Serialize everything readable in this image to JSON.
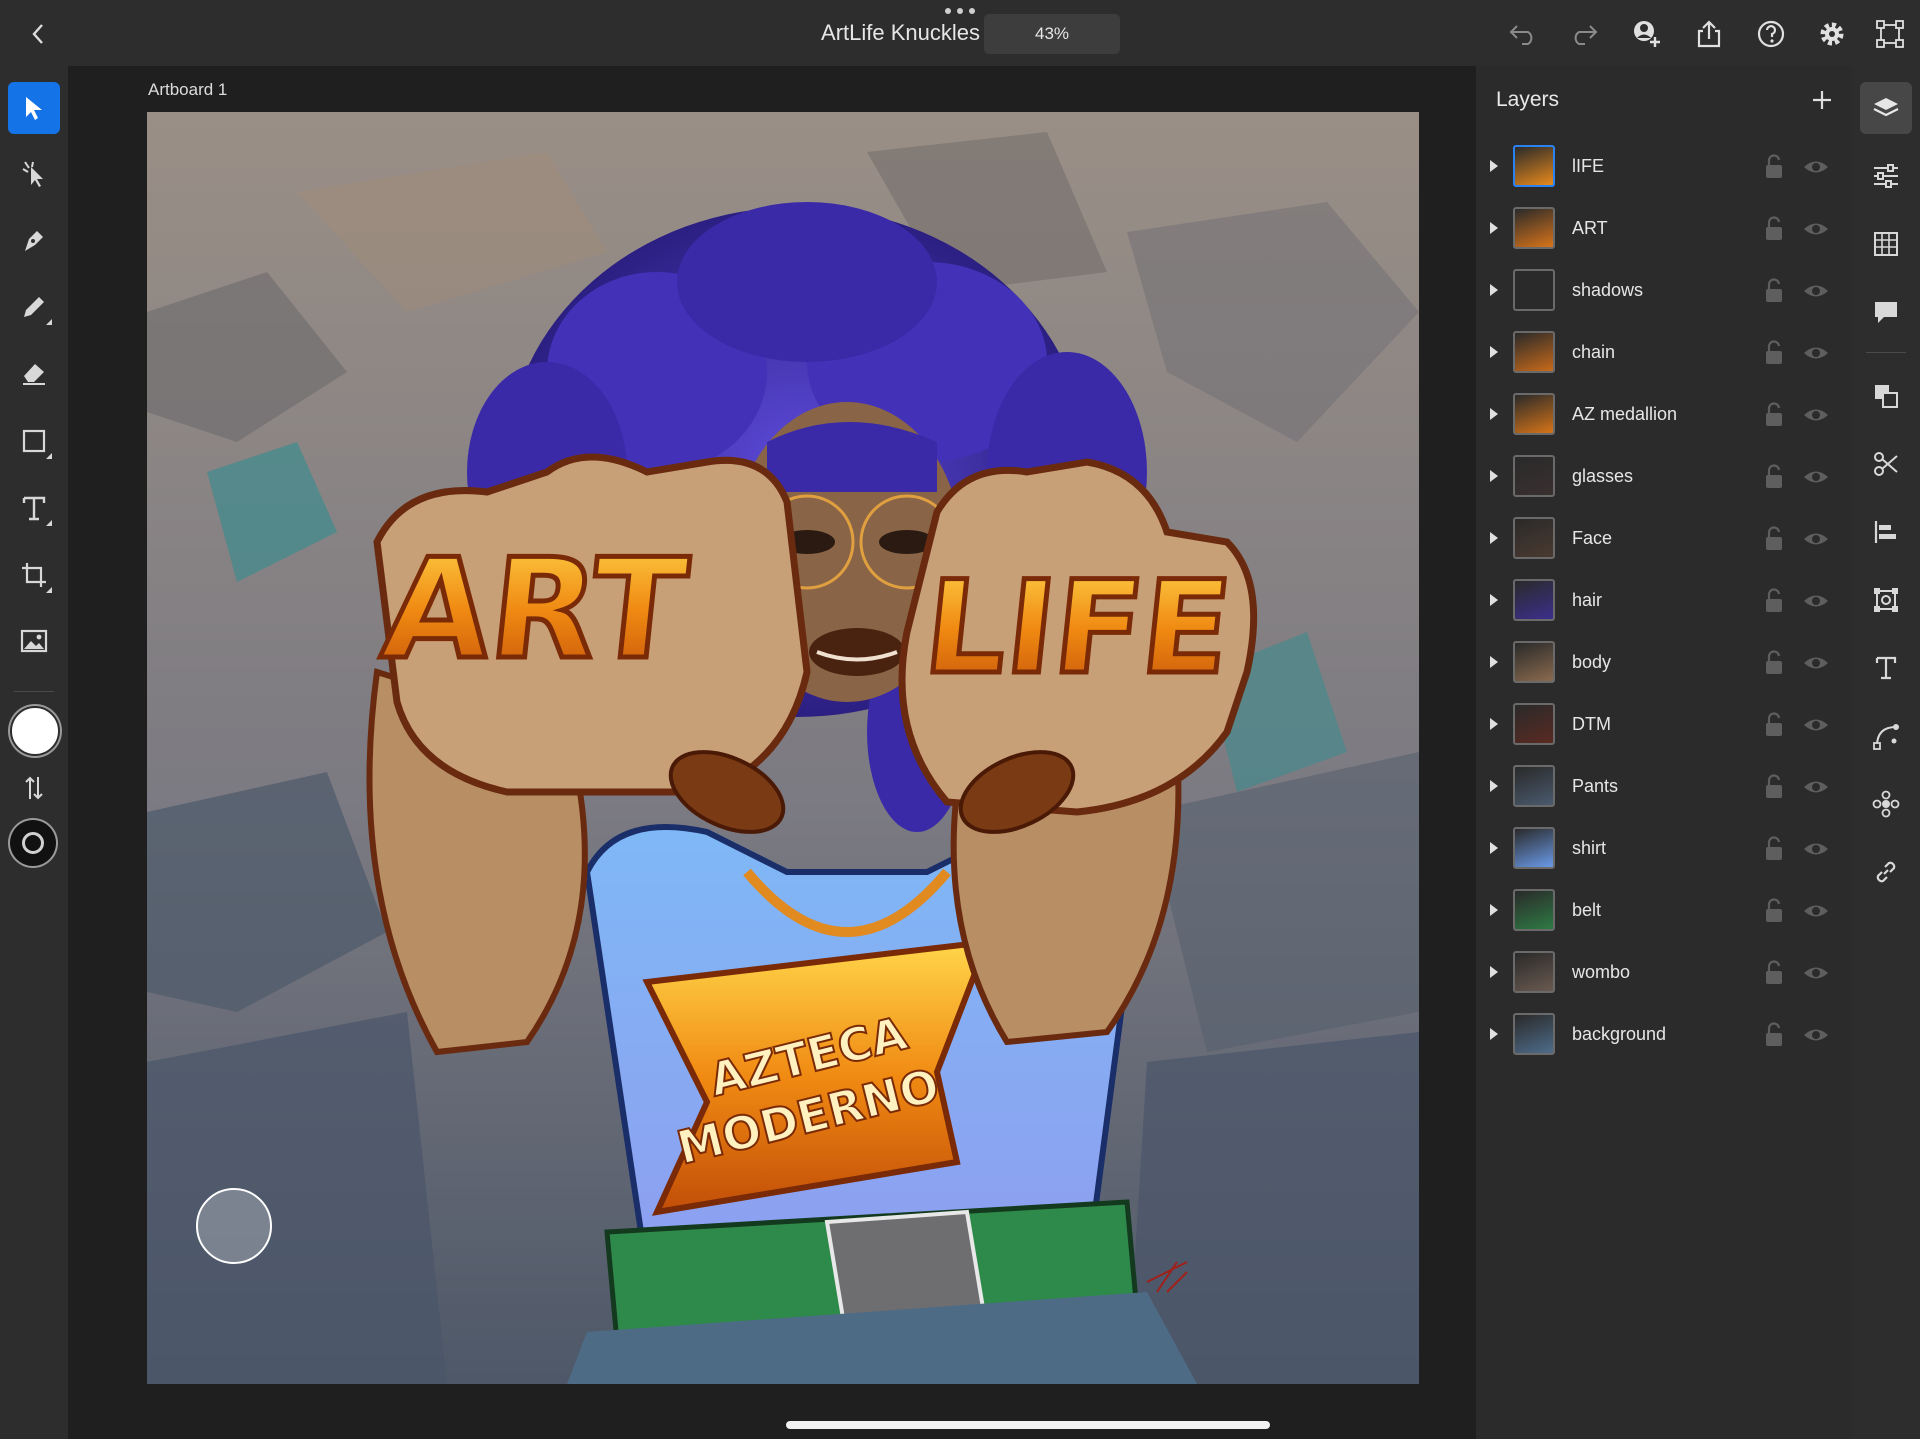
{
  "document": {
    "title": "ArtLife Knuckles",
    "zoom": "43%"
  },
  "canvas": {
    "artboard_label": "Artboard 1"
  },
  "artwork": {
    "headline_left": "ART",
    "headline_right": "LIFE",
    "medallion_line1": "AZTECA",
    "medallion_line2": "MODERNO"
  },
  "layers": {
    "title": "Layers",
    "items": [
      {
        "name": "lIFE",
        "selected": true,
        "thumb": "#e88a1c"
      },
      {
        "name": "ART",
        "selected": false,
        "thumb": "#d8741a"
      },
      {
        "name": "shadows",
        "selected": false,
        "thumb": "#2a2a2a"
      },
      {
        "name": "chain",
        "selected": false,
        "thumb": "#c86a1a"
      },
      {
        "name": "AZ medallion",
        "selected": false,
        "thumb": "#d67418"
      },
      {
        "name": "glasses",
        "selected": false,
        "thumb": "#3a3030"
      },
      {
        "name": "Face",
        "selected": false,
        "thumb": "#4a3a30"
      },
      {
        "name": "hair",
        "selected": false,
        "thumb": "#3b2f8c"
      },
      {
        "name": "body",
        "selected": false,
        "thumb": "#8a6a4e"
      },
      {
        "name": "DTM",
        "selected": false,
        "thumb": "#5a2a22"
      },
      {
        "name": "Pants",
        "selected": false,
        "thumb": "#4a5a6e"
      },
      {
        "name": "shirt",
        "selected": false,
        "thumb": "#6a9ae8"
      },
      {
        "name": "belt",
        "selected": false,
        "thumb": "#2e7a44"
      },
      {
        "name": "wombo",
        "selected": false,
        "thumb": "#6a5a50"
      },
      {
        "name": "background",
        "selected": false,
        "thumb": "#4e6c8a"
      }
    ]
  },
  "colors": {
    "accent": "#1473e6",
    "fill_swatch": "#ffffff",
    "stroke_swatch": "#111111"
  }
}
